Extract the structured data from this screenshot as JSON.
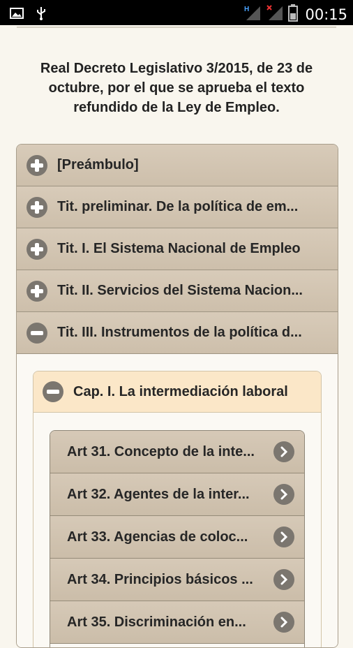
{
  "statusbar": {
    "time": "00:15",
    "icons": [
      "image-icon",
      "usb-icon",
      "signal-h-icon",
      "signal-x-icon",
      "battery-icon"
    ]
  },
  "document": {
    "title": "Real Decreto Legislativo 3/2015, de 23 de octubre, por el que se aprueba el texto refundido de la Ley de Empleo."
  },
  "sections": [
    {
      "label": "[Preámbulo]",
      "expanded": false
    },
    {
      "label": "Tit. preliminar. De la política de em...",
      "expanded": false
    },
    {
      "label": "Tit. I. El Sistema Nacional de Empleo",
      "expanded": false
    },
    {
      "label": "Tit. II. Servicios del Sistema Nacion...",
      "expanded": false
    },
    {
      "label": "Tit. III. Instrumentos de la política d...",
      "expanded": true
    }
  ],
  "chapter": {
    "label": "Cap. I. La intermediación laboral",
    "expanded": true
  },
  "articles": [
    {
      "label": "Art 31. Concepto de la inte..."
    },
    {
      "label": "Art 32. Agentes de la inter..."
    },
    {
      "label": "Art 33. Agencias de coloc..."
    },
    {
      "label": "Art 34. Principios básicos ..."
    },
    {
      "label": "Art 35. Discriminación en..."
    }
  ],
  "colors": {
    "header_bg": "#d2c5b2",
    "chapter_bg": "#fbe7c8",
    "icon_bg": "#7b766f",
    "page_bg": "#f9f6ee"
  }
}
